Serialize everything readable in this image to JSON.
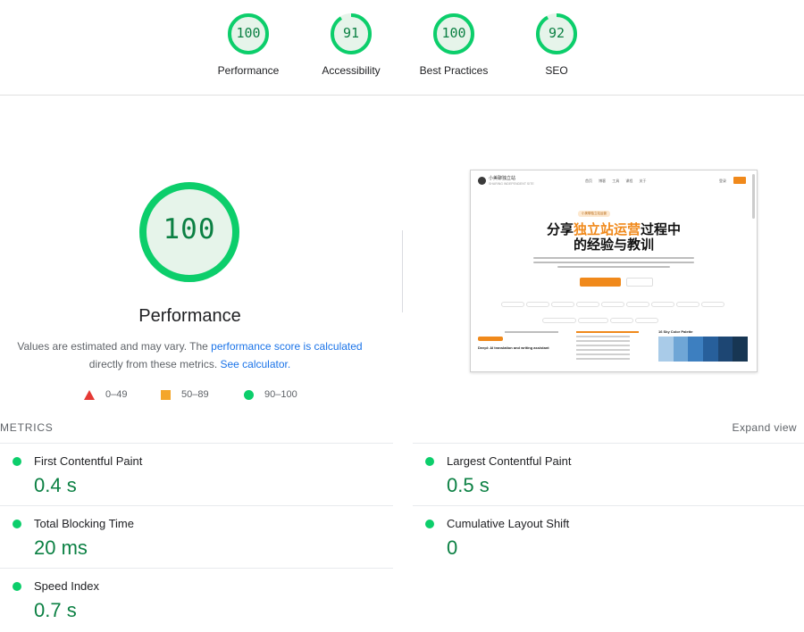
{
  "categories": [
    {
      "label": "Performance",
      "score": "100",
      "value": 100
    },
    {
      "label": "Accessibility",
      "score": "91",
      "value": 91
    },
    {
      "label": "Best Practices",
      "score": "100",
      "value": 100
    },
    {
      "label": "SEO",
      "score": "92",
      "value": 92
    }
  ],
  "main": {
    "score": "100",
    "value": 100,
    "title": "Performance",
    "desc_prefix": "Values are estimated and may vary. The ",
    "desc_link": "performance score is calculated",
    "desc_middle": " directly from these metrics. ",
    "calc_link": "See calculator.",
    "legend": [
      {
        "range": "0–49",
        "shape": "triangle",
        "color": "#e53935"
      },
      {
        "range": "50–89",
        "shape": "square",
        "color": "#f4a62a"
      },
      {
        "range": "90–100",
        "shape": "circle",
        "color": "#0cce6b"
      }
    ]
  },
  "screenshot": {
    "brand": "小美聊独立站",
    "brand_sub": "SHARING INDEPENDENT SITE",
    "menu": "首页 博客 工具 课程 关于",
    "login": "登录",
    "pill": "小美聊独立站运营",
    "headline_a": "分享",
    "headline_hl": "独立站运营",
    "headline_b": "过程中",
    "headline_line2": "的经验与教训",
    "card_title": "Deepl: AI translation and writing assistant",
    "palette_title": "16 Sky Color Palette",
    "palette": [
      "#a9cbe8",
      "#6fa6d6",
      "#3d7fc0",
      "#275f9b",
      "#1d4673",
      "#173653"
    ]
  },
  "metrics_header": "METRICS",
  "expand_label": "Expand view",
  "metrics": [
    {
      "name": "First Contentful Paint",
      "value": "0.4 s"
    },
    {
      "name": "Largest Contentful Paint",
      "value": "0.5 s"
    },
    {
      "name": "Total Blocking Time",
      "value": "20 ms"
    },
    {
      "name": "Cumulative Layout Shift",
      "value": "0"
    },
    {
      "name": "Speed Index",
      "value": "0.7 s"
    }
  ],
  "colors": {
    "pass": "#0cce6b",
    "pass_text": "#0b8043",
    "pass_fill": "#e6f4ea",
    "link": "#1a73e8"
  }
}
